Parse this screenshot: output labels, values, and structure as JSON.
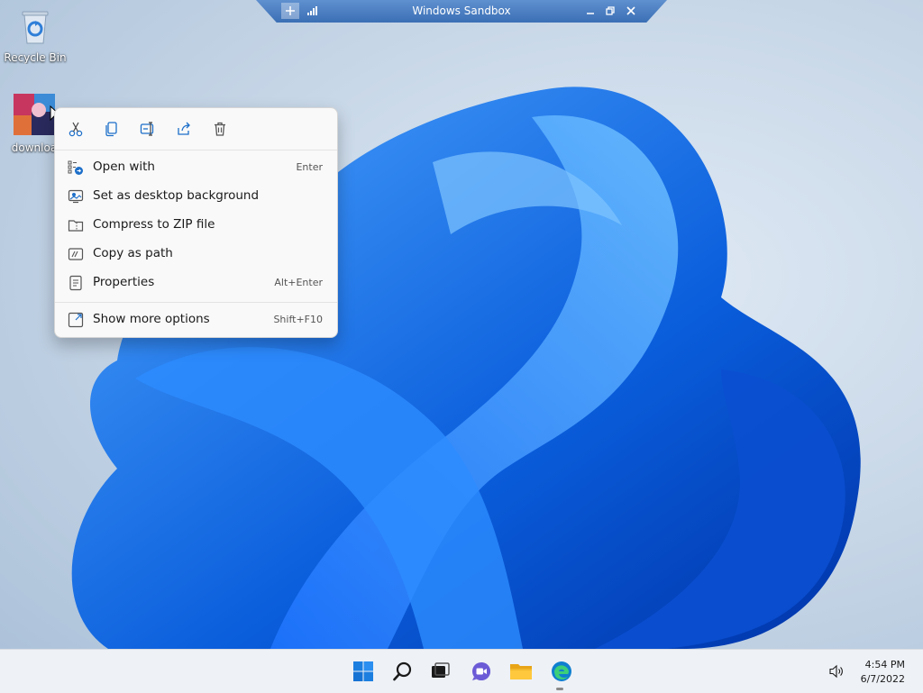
{
  "sandbox": {
    "title": "Windows Sandbox"
  },
  "desktop": {
    "recycle_bin_label": "Recycle Bin",
    "file_label": "downloa"
  },
  "context_menu": {
    "toolbar": [
      "cut-icon",
      "copy-icon",
      "rename-icon",
      "share-icon",
      "delete-icon"
    ],
    "items": [
      {
        "label": "Open with",
        "shortcut": "Enter",
        "icon": "open-with-icon"
      },
      {
        "label": "Set as desktop background",
        "shortcut": "",
        "icon": "desktop-background-icon"
      },
      {
        "label": "Compress to ZIP file",
        "shortcut": "",
        "icon": "zip-icon"
      },
      {
        "label": "Copy as path",
        "shortcut": "",
        "icon": "copy-path-icon"
      },
      {
        "label": "Properties",
        "shortcut": "Alt+Enter",
        "icon": "properties-icon"
      },
      {
        "label": "Show more options",
        "shortcut": "Shift+F10",
        "icon": "more-options-icon"
      }
    ]
  },
  "taskbar": {
    "apps": [
      "start-icon",
      "search-icon",
      "task-view-icon",
      "chat-icon",
      "file-explorer-icon",
      "edge-icon"
    ],
    "time": "4:54 PM",
    "date": "6/7/2022"
  },
  "colors": {
    "accent": "#0a5ddb",
    "menu_bg": "#f9f9f9",
    "taskbar_bg": "#eef1f6"
  }
}
